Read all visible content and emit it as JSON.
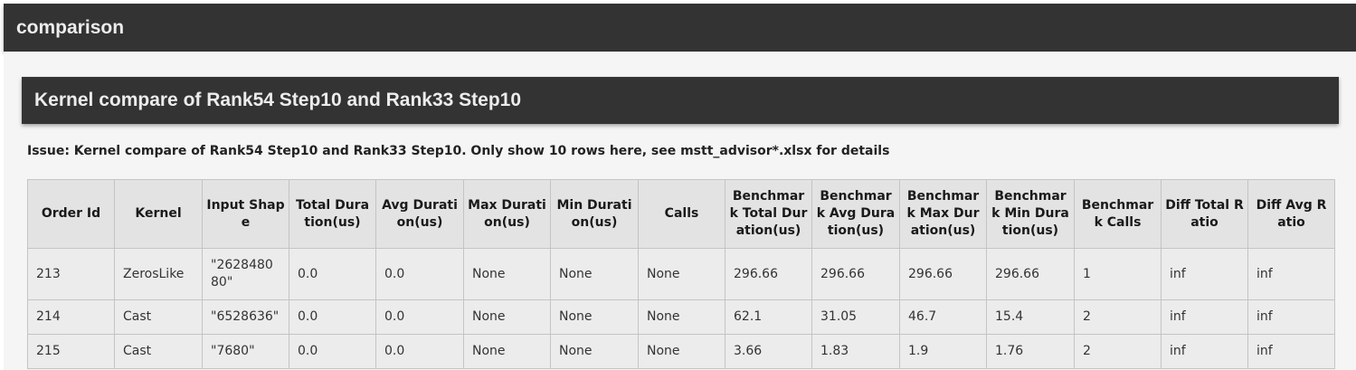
{
  "header": {
    "title": "comparison"
  },
  "section": {
    "title": "Kernel compare of Rank54 Step10 and Rank33 Step10"
  },
  "issue_text": "Issue: Kernel compare of Rank54 Step10 and Rank33 Step10. Only show 10 rows here, see mstt_advisor*.xlsx for details",
  "table": {
    "columns": [
      "Order Id",
      "Kernel",
      "Input Shape",
      "Total Duration(us)",
      "Avg Duration(us)",
      "Max Duration(us)",
      "Min Duration(us)",
      "Calls",
      "Benchmark Total Duration(us)",
      "Benchmark Avg Duration(us)",
      "Benchmark Max Duration(us)",
      "Benchmark Min Duration(us)",
      "Benchmark Calls",
      "Diff Total Ratio",
      "Diff Avg Ratio"
    ],
    "rows": [
      [
        "213",
        "ZerosLike",
        "\"262848080\"",
        "0.0",
        "0.0",
        "None",
        "None",
        "None",
        "296.66",
        "296.66",
        "296.66",
        "296.66",
        "1",
        "inf",
        "inf"
      ],
      [
        "214",
        "Cast",
        "\"6528636\"",
        "0.0",
        "0.0",
        "None",
        "None",
        "None",
        "62.1",
        "31.05",
        "46.7",
        "15.4",
        "2",
        "inf",
        "inf"
      ],
      [
        "215",
        "Cast",
        "\"7680\"",
        "0.0",
        "0.0",
        "None",
        "None",
        "None",
        "3.66",
        "1.83",
        "1.9",
        "1.76",
        "2",
        "inf",
        "inf"
      ]
    ]
  }
}
